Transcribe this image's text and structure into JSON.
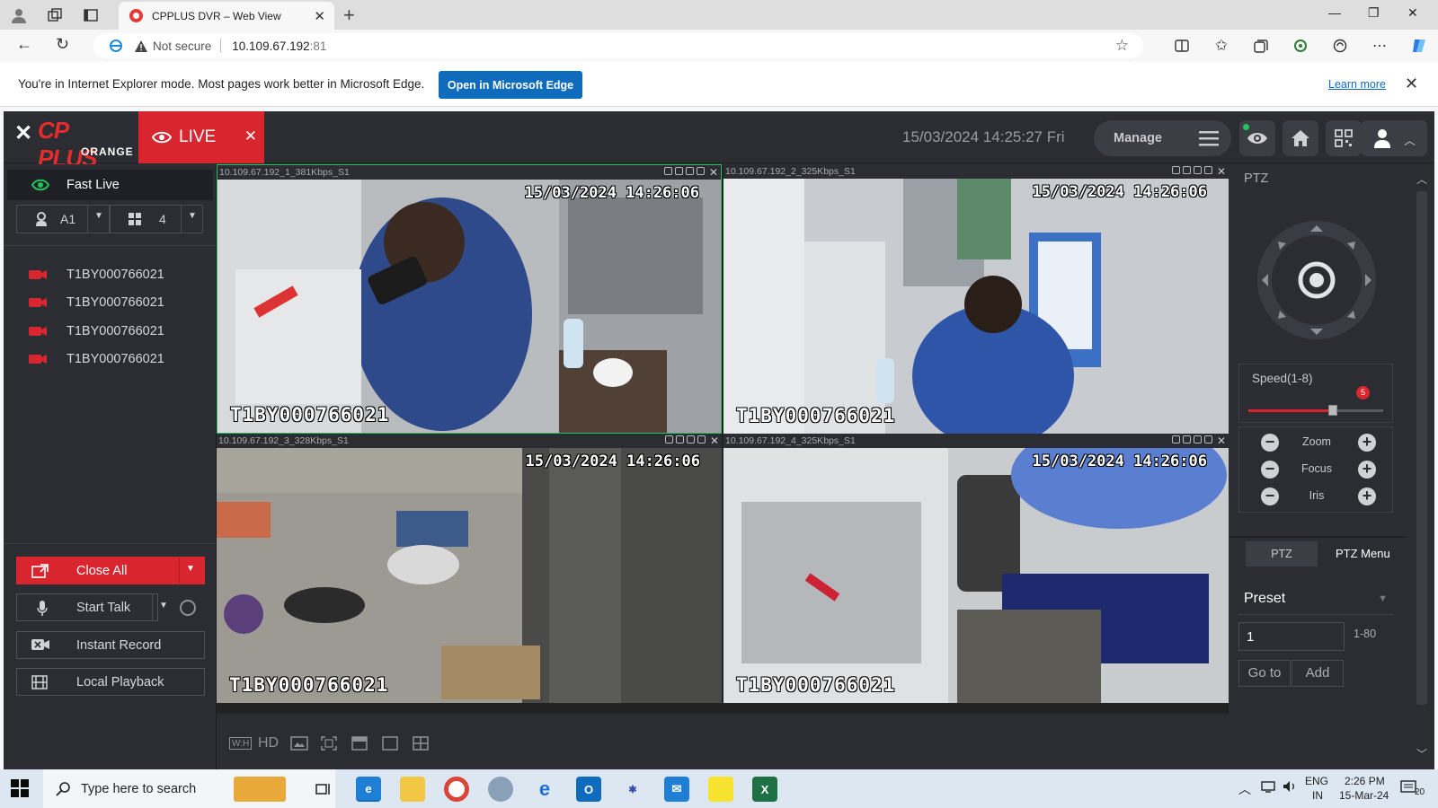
{
  "browser": {
    "tab_title": "CPPLUS DVR – Web View",
    "address_security": "Not secure",
    "address_host": "10.109.67.192",
    "address_port": ":81",
    "infobar_message": "You're in Internet Explorer mode. Most pages work better in Microsoft Edge.",
    "open_edge_label": "Open in Microsoft Edge",
    "learn_more_label": "Learn more"
  },
  "app": {
    "logo_text": "CP PLUS",
    "logo_sub": "ORANGE",
    "live_tab_label": "LIVE",
    "datetime": "15/03/2024 14:25:27 Fri",
    "manage_label": "Manage",
    "accent_color": "#d9262e"
  },
  "sidebar": {
    "fast_live_label": "Fast Live",
    "account_label": "A1",
    "split_label": "4",
    "channels": [
      {
        "label": "T1BY000766021"
      },
      {
        "label": "T1BY000766021"
      },
      {
        "label": "T1BY000766021"
      },
      {
        "label": "T1BY000766021"
      }
    ],
    "close_all_label": "Close All",
    "start_talk_label": "Start Talk",
    "instant_record_label": "Instant Record",
    "local_playback_label": "Local Playback"
  },
  "video": {
    "tiles": [
      {
        "stream": "10.109.67.192_1_381Kbps_S1",
        "osd_time": "15/03/2024 14:26:06",
        "osd_name": "T1BY000766021",
        "selected": true
      },
      {
        "stream": "10.109.67.192_2_325Kbps_S1",
        "osd_time": "15/03/2024 14:26:06",
        "osd_name": "T1BY000766021",
        "selected": false
      },
      {
        "stream": "10.109.67.192_3_328Kbps_S1",
        "osd_time": "15/03/2024 14:26:06",
        "osd_name": "T1BY000766021",
        "selected": false
      },
      {
        "stream": "10.109.67.192_4_325Kbps_S1",
        "osd_time": "15/03/2024 14:26:06",
        "osd_name": "T1BY000766021",
        "selected": false
      }
    ],
    "bottom_toolbar": {
      "ratio_label": "W:H",
      "hd_label": "HD"
    }
  },
  "ptz": {
    "title": "PTZ",
    "speed_label": "Speed(1-8)",
    "speed_value": 5,
    "speed_max": 8,
    "zoom_label": "Zoom",
    "focus_label": "Focus",
    "iris_label": "Iris",
    "tab_ptz_label": "PTZ",
    "tab_menu_label": "PTZ Menu",
    "preset_label": "Preset",
    "preset_value": "1",
    "preset_range": "1-80",
    "goto_label": "Go to",
    "add_label": "Add"
  },
  "taskbar": {
    "search_placeholder": "Type here to search",
    "lang_top": "ENG",
    "lang_bottom": "IN",
    "time": "2:26 PM",
    "date": "15-Mar-24",
    "notification_count": "20"
  }
}
